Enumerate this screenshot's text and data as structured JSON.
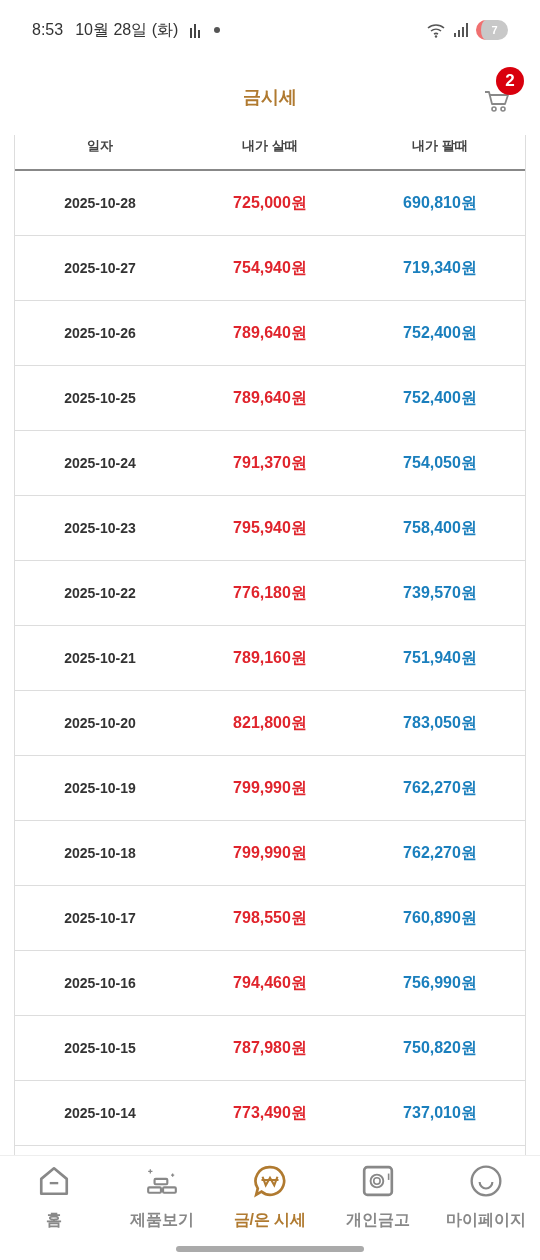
{
  "status_bar": {
    "time": "8:53",
    "date": "10월 28일 (화)",
    "battery": "7"
  },
  "header": {
    "title": "금시세",
    "cart_count": "2"
  },
  "table": {
    "columns": [
      "일자",
      "내가 살때",
      "내가 팔때"
    ],
    "rows": [
      {
        "date": "2025-10-28",
        "buy": "725,000원",
        "sell": "690,810원"
      },
      {
        "date": "2025-10-27",
        "buy": "754,940원",
        "sell": "719,340원"
      },
      {
        "date": "2025-10-26",
        "buy": "789,640원",
        "sell": "752,400원"
      },
      {
        "date": "2025-10-25",
        "buy": "789,640원",
        "sell": "752,400원"
      },
      {
        "date": "2025-10-24",
        "buy": "791,370원",
        "sell": "754,050원"
      },
      {
        "date": "2025-10-23",
        "buy": "795,940원",
        "sell": "758,400원"
      },
      {
        "date": "2025-10-22",
        "buy": "776,180원",
        "sell": "739,570원"
      },
      {
        "date": "2025-10-21",
        "buy": "789,160원",
        "sell": "751,940원"
      },
      {
        "date": "2025-10-20",
        "buy": "821,800원",
        "sell": "783,050원"
      },
      {
        "date": "2025-10-19",
        "buy": "799,990원",
        "sell": "762,270원"
      },
      {
        "date": "2025-10-18",
        "buy": "799,990원",
        "sell": "762,270원"
      },
      {
        "date": "2025-10-17",
        "buy": "798,550원",
        "sell": "760,890원"
      },
      {
        "date": "2025-10-16",
        "buy": "794,460원",
        "sell": "756,990원"
      },
      {
        "date": "2025-10-15",
        "buy": "787,980원",
        "sell": "750,820원"
      },
      {
        "date": "2025-10-14",
        "buy": "773,490원",
        "sell": "737,010원"
      }
    ]
  },
  "nav": [
    {
      "kind": "home",
      "label": "홈",
      "selected": false
    },
    {
      "kind": "products",
      "label": "제품보기",
      "selected": false
    },
    {
      "kind": "price",
      "label": "금/은 시세",
      "selected": true
    },
    {
      "kind": "vault",
      "label": "개인금고",
      "selected": false
    },
    {
      "kind": "mypage",
      "label": "마이페이지",
      "selected": false
    }
  ]
}
